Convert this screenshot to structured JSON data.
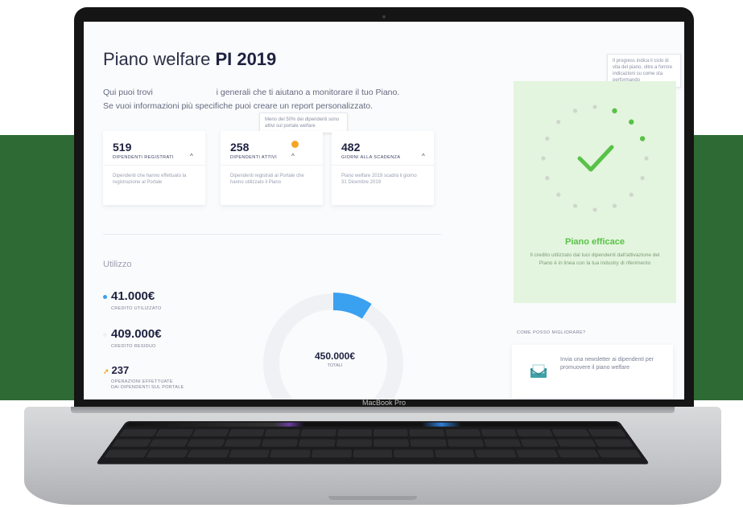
{
  "device": {
    "label": "MacBook Pro"
  },
  "dashboard": {
    "title_prefix": "Piano welfare",
    "title_bold": "PI 2019",
    "intro_line1": "Qui puoi trovi                           i generali che ti aiutano a monitorare il tuo Piano.",
    "intro_line2": "Se vuoi informazioni più specifiche puoi creare un report personalizzato."
  },
  "tooltips": {
    "active_employees": "Meno del 50% dei dipendenti sono attivi sul portale welfare",
    "progress": "Il progress indica il ciclo di vita del piano, oltre a fornire indicazioni su come sta performando"
  },
  "stats": [
    {
      "value": "519",
      "label": "DIPENDENTI REGISTRATI",
      "description": "Dipendenti che hanno effettuato la registrazione al Portale"
    },
    {
      "value": "258",
      "label": "DIPENDENTI ATTIVI",
      "description": "Dipendenti registrati al Portale che hanno utilizzato il Piano"
    },
    {
      "value": "482",
      "label": "GIORNI ALLA SCADENZA",
      "description": "Piano welfare 2019 scadrà il giorno 31 Dicembre 2019"
    }
  ],
  "usage": {
    "section_title": "Utilizzo",
    "used_value": "41.000€",
    "used_label": "CREDITO UTILIZZATO",
    "remaining_value": "409.000€",
    "remaining_label": "CREDITO RESIDUO",
    "operations_value": "237",
    "operations_label_1": "OPERAZIONI EFFETTUATE",
    "operations_label_2": "DAI DIPENDENTI SUL PORTALE",
    "total_value": "450.000€",
    "total_label": "TOTALI",
    "used_amount": 41000,
    "total_amount": 450000
  },
  "efficiency": {
    "title": "Piano efficace",
    "description": "Il credito utilizzato dai tuoi dipendenti dall'attivazione del Piano è in linea con la tua industry di riferimento"
  },
  "improve": {
    "heading": "COME POSSO MIGLIORARE?",
    "tip": "Invia una newsletter ai dipendenti per promuovere il piano welfare"
  },
  "colors": {
    "background_band": "#2e6b34",
    "accent_blue": "#3aa0f0",
    "success_green": "#59c149",
    "panel_green": "#e3f5de",
    "warning_orange": "#f5a623",
    "text_dark": "#1e2240"
  },
  "icons": {
    "check": "check-icon",
    "chevron": "chevron-up-icon",
    "mail": "mail-icon",
    "warning": "warning-badge-icon"
  }
}
